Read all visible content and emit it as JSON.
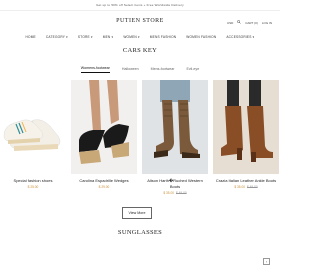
{
  "topbar": {
    "text": "Get up to 50% off Select items + Free Worldwide Delivery"
  },
  "header": {
    "logo": "PUTIEN STORE",
    "currency": "USD",
    "cart": "CART (0)",
    "login": "LOG IN"
  },
  "nav": {
    "items": [
      "HOME",
      "CATEGORY",
      "STORE",
      "MEN",
      "WOMEN",
      "MENS FASHION",
      "WOMEN FASHION",
      "ACCESSORIES"
    ],
    "dropdown_items": [
      "CATEGORY",
      "STORE",
      "MEN",
      "WOMEN",
      "ACCESSORIES"
    ]
  },
  "section1": {
    "title": "CARS KEY",
    "tabs": [
      "Womens-footwear",
      "Halloween",
      "Mens-footwear",
      "Evil-eye"
    ],
    "active_tab": "Womens-footwear"
  },
  "products": [
    {
      "name": "Special fashion shoes",
      "price": "$ 25.00",
      "old_price": ""
    },
    {
      "name": "Carolina Espadrille Wedges",
      "price": "$ 29.00",
      "old_price": ""
    },
    {
      "name": "Alison Harth�Ruched Western Boots",
      "price": "$ 35.00",
      "old_price": "$ 49.00"
    },
    {
      "name": "Crazia Italian Leather Ankle Boots",
      "price": "$ 35.00",
      "old_price": "$ 49.00"
    }
  ],
  "view_more_label": "View More",
  "section2": {
    "title": "SUNGLASSES"
  },
  "colors": {
    "accent_price": "#c9913a",
    "text": "#222222"
  }
}
